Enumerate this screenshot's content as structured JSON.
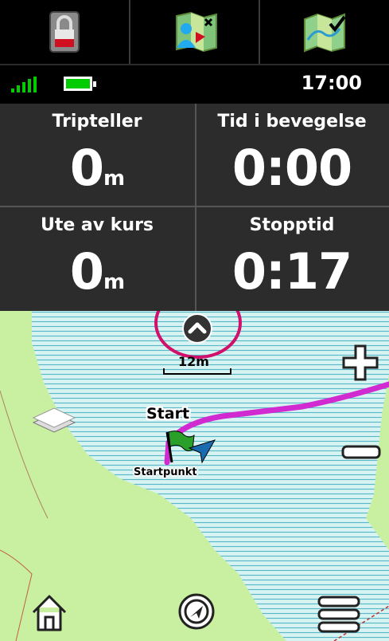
{
  "toolbar": {
    "items": [
      {
        "icon": "lock-icon"
      },
      {
        "icon": "map-user-icon"
      },
      {
        "icon": "map-check-icon"
      }
    ]
  },
  "status": {
    "time": "17:00",
    "battery_color": "#00cc00"
  },
  "fields": [
    {
      "label": "Tripteller",
      "value": "0",
      "unit": "m"
    },
    {
      "label": "Tid i bevegelse",
      "value": "0:00",
      "unit": ""
    },
    {
      "label": "Ute av kurs",
      "value": "0",
      "unit": "m"
    },
    {
      "label": "Stopptid",
      "value": "0:17",
      "unit": ""
    }
  ],
  "map": {
    "scale": "12m",
    "start_label": "Start",
    "waypoint_label": "Startpunkt",
    "track_color": "#d02ad0",
    "highlight_color": "#d0106a"
  },
  "nav": {
    "home_icon": "home-icon",
    "compass_icon": "compass-icon",
    "menu_icon": "menu-icon"
  }
}
